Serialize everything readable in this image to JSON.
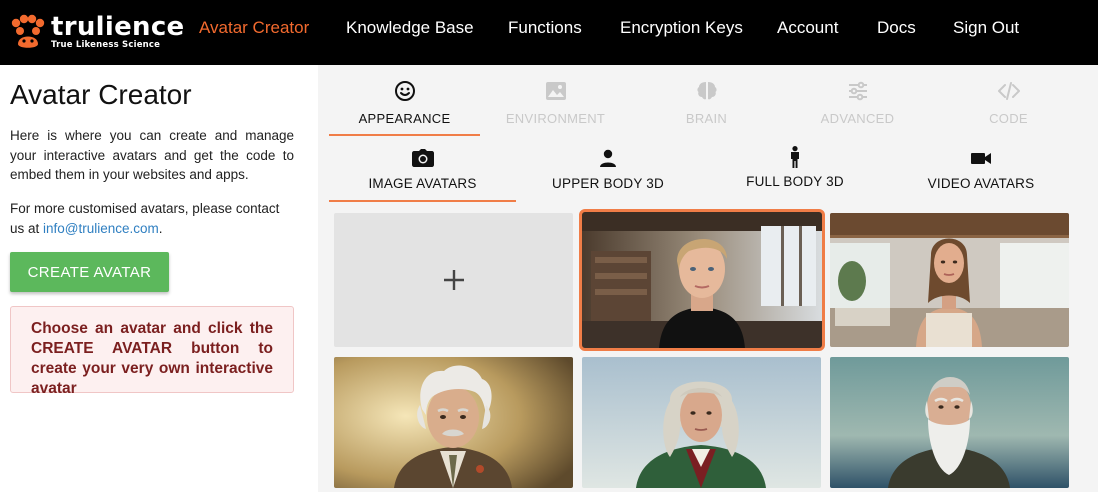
{
  "brand": {
    "name": "trulience",
    "tagline": "True Likeness Science",
    "color": "#f26a2e"
  },
  "nav": {
    "items": [
      {
        "label": "Avatar Creator",
        "active": true
      },
      {
        "label": "Knowledge Base"
      },
      {
        "label": "Functions"
      },
      {
        "label": "Encryption Keys"
      },
      {
        "label": "Account"
      },
      {
        "label": "Docs"
      },
      {
        "label": "Sign Out"
      }
    ]
  },
  "left": {
    "title": "Avatar Creator",
    "intro": "Here is where you can create and manage your interactive avatars and get the code to embed them in your websites and apps.",
    "contact_prefix": "For more customised avatars, please contact us at ",
    "contact_email": "info@trulience.com",
    "contact_suffix": ".",
    "create_button": "CREATE AVATAR",
    "notice": "Choose an avatar and click the CREATE AVATAR button to create your very own interactive avatar"
  },
  "section_tabs": [
    {
      "label": "APPEARANCE",
      "icon": "smiley-icon",
      "active": true
    },
    {
      "label": "ENVIRONMENT",
      "icon": "image-icon"
    },
    {
      "label": "BRAIN",
      "icon": "brain-icon"
    },
    {
      "label": "ADVANCED",
      "icon": "sliders-icon"
    },
    {
      "label": "CODE",
      "icon": "code-icon"
    }
  ],
  "avatar_type_tabs": [
    {
      "label": "IMAGE AVATARS",
      "icon": "camera-icon",
      "active": true
    },
    {
      "label": "UPPER BODY 3D",
      "icon": "person-bust-icon"
    },
    {
      "label": "FULL BODY 3D",
      "icon": "person-standing-icon"
    },
    {
      "label": "VIDEO AVATARS",
      "icon": "video-camera-icon"
    }
  ],
  "avatar_grid": {
    "add_label": "+",
    "selected_index": 1,
    "accent": "#f07d47"
  }
}
